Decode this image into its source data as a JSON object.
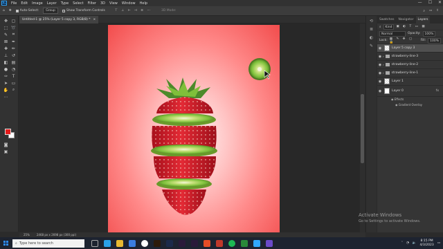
{
  "menubar": {
    "logo": "Ps",
    "items": [
      "File",
      "Edit",
      "Image",
      "Layer",
      "Type",
      "Select",
      "Filter",
      "3D",
      "View",
      "Window",
      "Help"
    ],
    "minimize": "—",
    "maximize": "☐",
    "close": "✕"
  },
  "options": {
    "auto_select_label": "Auto-Select:",
    "auto_select_value": "Group",
    "transform_label": "Show Transform Controls",
    "mode_label": "3D Mode:"
  },
  "document": {
    "tab_title": "Untitled-1 @ 25% (Layer 5 copy 3, RGB/8) *",
    "tab_close": "×"
  },
  "status": {
    "zoom": "25%",
    "size": "2468 px x 2698 px (300 ppi)"
  },
  "panel": {
    "tabs": [
      "Swatches",
      "Navigator",
      "Layers"
    ],
    "filter_label": "Kind",
    "blend_mode": "Normal",
    "opacity_label": "Opacity:",
    "opacity_value": "100%",
    "lock_label": "Lock:",
    "fill_label": "Fill:",
    "fill_value": "100%",
    "layers": [
      {
        "name": "Layer 5 copy 3",
        "type": "layer",
        "thumb": "chk",
        "selected": true
      },
      {
        "name": "strawberry-line-3",
        "type": "group"
      },
      {
        "name": "strawberry-line-2",
        "type": "group"
      },
      {
        "name": "strawberry-line-1",
        "type": "group"
      },
      {
        "name": "Layer 1",
        "type": "layer",
        "thumb": "chk"
      },
      {
        "name": "Layer 0",
        "type": "layer",
        "thumb": "white",
        "fx": "fx"
      }
    ],
    "effects_label": "Effects",
    "effect_item": "Gradient Overlay"
  },
  "watermark": {
    "title": "Activate Windows",
    "subtitle": "Go to Settings to activate Windows."
  },
  "taskbar": {
    "search_placeholder": "Type here to search",
    "time": "8:15 PM",
    "date": "4/3/2023"
  },
  "colors": {
    "accent": "#31a8ff",
    "foreground": "#e31a1a",
    "background": "#ffffff",
    "strawberry": "#d91c2a",
    "kiwi": "#7cc03a"
  }
}
